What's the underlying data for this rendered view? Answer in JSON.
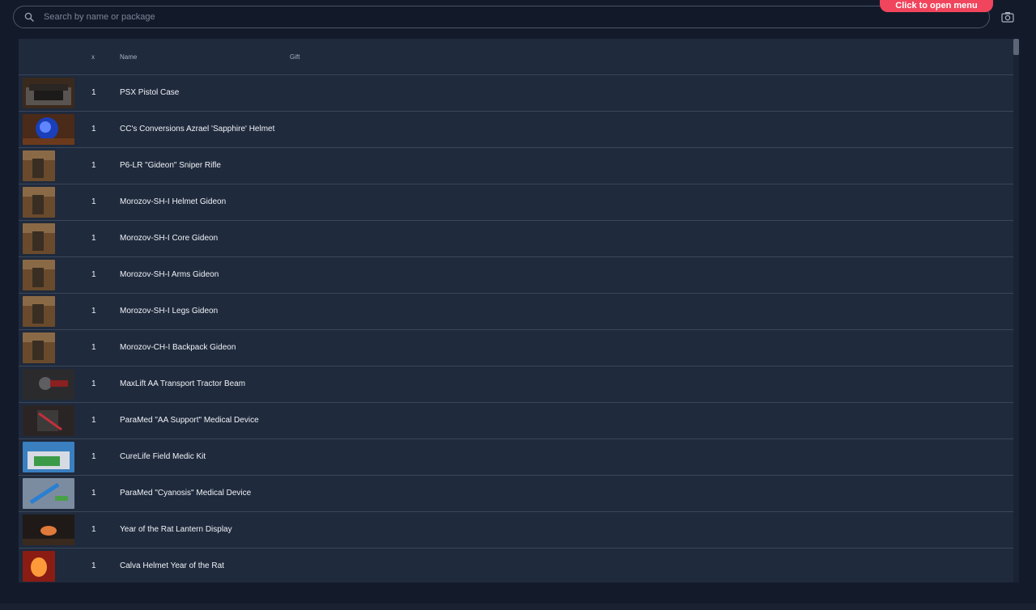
{
  "search": {
    "placeholder": "Search by name or package"
  },
  "header_button": {
    "label": "Click to open menu"
  },
  "table": {
    "headers": {
      "x": "x",
      "name": "Name",
      "gift": "Gift"
    },
    "rows": [
      {
        "qty": "1",
        "name": "PSX Pistol Case"
      },
      {
        "qty": "1",
        "name": "CC's Conversions Azrael 'Sapphire' Helmet"
      },
      {
        "qty": "1",
        "name": "P6-LR \"Gideon\" Sniper Rifle"
      },
      {
        "qty": "1",
        "name": "Morozov-SH-I Helmet Gideon"
      },
      {
        "qty": "1",
        "name": "Morozov-SH-I Core Gideon"
      },
      {
        "qty": "1",
        "name": "Morozov-SH-I Arms Gideon"
      },
      {
        "qty": "1",
        "name": "Morozov-SH-I Legs Gideon"
      },
      {
        "qty": "1",
        "name": "Morozov-CH-I Backpack Gideon"
      },
      {
        "qty": "1",
        "name": "MaxLift AA Transport Tractor Beam"
      },
      {
        "qty": "1",
        "name": "ParaMed \"AA Support\" Medical Device"
      },
      {
        "qty": "1",
        "name": "CureLife Field Medic Kit"
      },
      {
        "qty": "1",
        "name": "ParaMed \"Cyanosis\" Medical Device"
      },
      {
        "qty": "1",
        "name": "Year of the Rat Lantern Display"
      },
      {
        "qty": "1",
        "name": "Calva Helmet Year of the Rat"
      }
    ]
  },
  "colors": {
    "background": "#131b2b",
    "table_bg": "#1f2a3c",
    "accent": "#f0455c"
  }
}
